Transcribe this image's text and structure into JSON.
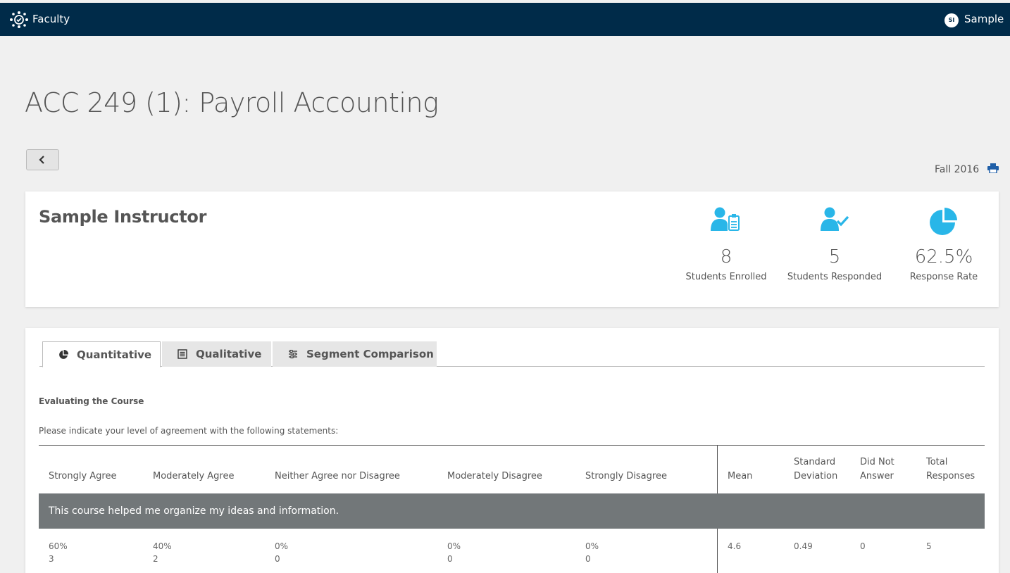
{
  "header": {
    "app_name": "Faculty",
    "user_initials": "SI",
    "user_name": "Sample"
  },
  "page": {
    "title": "ACC 249 (1): Payroll Accounting",
    "term": "Fall 2016"
  },
  "instructor": {
    "name": "Sample Instructor",
    "stats": [
      {
        "value": "8",
        "label": "Students Enrolled",
        "icon": "user-clipboard-icon"
      },
      {
        "value": "5",
        "label": "Students Responded",
        "icon": "user-check-icon"
      },
      {
        "value": "62.5%",
        "label": "Response Rate",
        "icon": "pie-chart-icon"
      }
    ]
  },
  "tabs": [
    {
      "label": "Quantitative",
      "icon": "pie-chart-icon",
      "active": true
    },
    {
      "label": "Qualitative",
      "icon": "list-icon",
      "active": false
    },
    {
      "label": "Segment Comparison",
      "icon": "sliders-icon",
      "active": false
    }
  ],
  "survey": {
    "section_title": "Evaluating the Course",
    "instructions": "Please indicate your level of agreement with the following statements:",
    "columns": {
      "strongly_agree": "Strongly Agree",
      "moderately_agree": "Moderately Agree",
      "neither": "Neither Agree nor Disagree",
      "moderately_disagree": "Moderately Disagree",
      "strongly_disagree": "Strongly Disagree",
      "mean": "Mean",
      "std_dev_1": "Standard",
      "std_dev_2": "Deviation",
      "dna_1": "Did Not",
      "dna_2": "Answer",
      "total_1": "Total",
      "total_2": "Responses"
    },
    "question": "This course helped me organize my ideas and information.",
    "row": {
      "strongly_agree_pct": "60%",
      "strongly_agree_n": "3",
      "moderately_agree_pct": "40%",
      "moderately_agree_n": "2",
      "neither_pct": "0%",
      "neither_n": "0",
      "moderately_disagree_pct": "0%",
      "moderately_disagree_n": "0",
      "strongly_disagree_pct": "0%",
      "strongly_disagree_n": "0",
      "mean": "4.6",
      "std_dev": "0.49",
      "did_not_answer": "0",
      "total": "5"
    }
  },
  "colors": {
    "header_bg": "#002b49",
    "accent": "#29b6e8",
    "question_row": "#727779"
  }
}
